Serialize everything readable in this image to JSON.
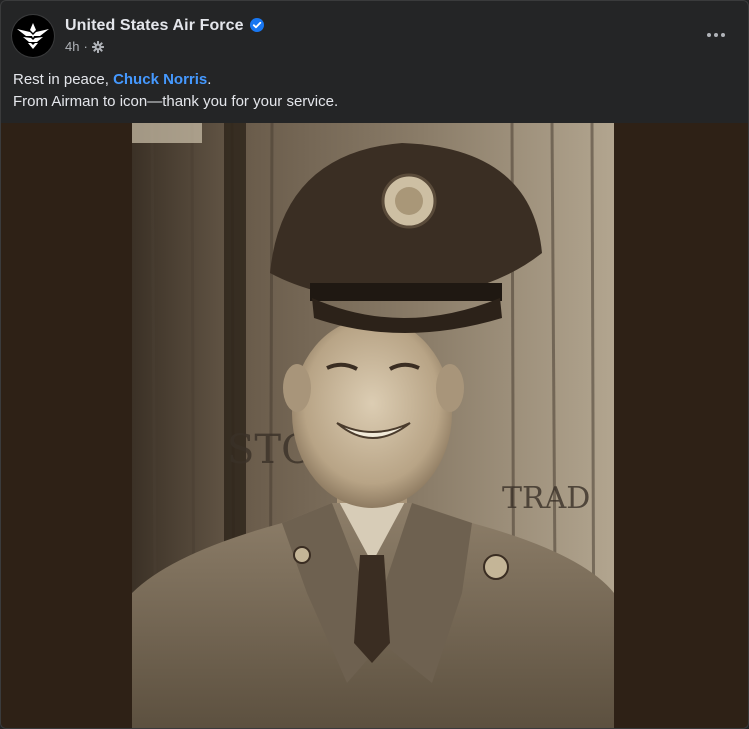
{
  "post": {
    "page_name": "United States Air Force",
    "verified": true,
    "timestamp": "4h",
    "separator": "·",
    "audience_icon": "gear-icon",
    "more_icon": "more-options-icon",
    "caption": {
      "line1_prefix": "Rest in peace, ",
      "mention": "Chuck Norris",
      "line1_suffix": ".",
      "line2": "From Airman to icon—thank you for your service."
    },
    "photo": {
      "visible_text": [
        "STO",
        "TRAD"
      ],
      "description_icon": "photo-icon"
    }
  },
  "colors": {
    "background": "#242526",
    "text_primary": "#e4e6eb",
    "text_secondary": "#b0b3b8",
    "mention": "#4599ff",
    "verified_badge": "#1877f2",
    "media_background": "#2e2116"
  }
}
